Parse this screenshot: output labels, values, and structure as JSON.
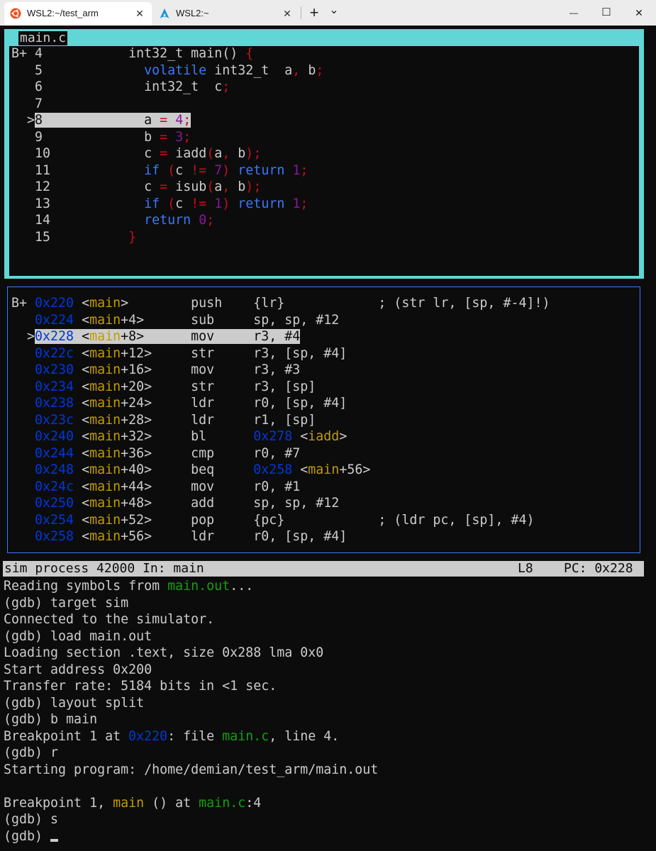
{
  "window": {
    "tabs": [
      {
        "title": "WSL2:~/test_arm",
        "icon": "ubuntu-icon",
        "active": true
      },
      {
        "title": "WSL2:~",
        "icon": "arch-icon",
        "active": false
      }
    ],
    "new_tab": "+",
    "dropdown": "⌄",
    "minimize": "—",
    "maximize": "☐",
    "close": "✕",
    "tab_close": "✕"
  },
  "source": {
    "filename": "main.c",
    "lines": [
      {
        "marker": "B+",
        "num": "4",
        "code": "int32_t main() {"
      },
      {
        "marker": "",
        "num": "5",
        "code": "volatile int32_t  a, b;"
      },
      {
        "marker": "",
        "num": "6",
        "code": "int32_t  c;"
      },
      {
        "marker": "",
        "num": "7",
        "code": ""
      },
      {
        "marker": ">",
        "num": "8",
        "code": "a = 4;",
        "current": true
      },
      {
        "marker": "",
        "num": "9",
        "code": "b = 3;"
      },
      {
        "marker": "",
        "num": "10",
        "code": "c = iadd(a, b);"
      },
      {
        "marker": "",
        "num": "11",
        "code": "if (c != 7) return 1;"
      },
      {
        "marker": "",
        "num": "12",
        "code": "c = isub(a, b);"
      },
      {
        "marker": "",
        "num": "13",
        "code": "if (c != 1) return 1;"
      },
      {
        "marker": "",
        "num": "14",
        "code": "return 0;"
      },
      {
        "marker": "",
        "num": "15",
        "code": "}"
      }
    ]
  },
  "asm": {
    "lines": [
      {
        "marker": "B+",
        "addr": "0x220",
        "sym": "main",
        "off": "",
        "op": "push",
        "args": "{lr}",
        "comment": "; (str lr, [sp, #-4]!)"
      },
      {
        "marker": "",
        "addr": "0x224",
        "sym": "main",
        "off": "+4",
        "op": "sub",
        "args": "sp, sp, #12",
        "comment": ""
      },
      {
        "marker": ">",
        "addr": "0x228",
        "sym": "main",
        "off": "+8",
        "op": "mov",
        "args": "r3, #4",
        "comment": "",
        "current": true
      },
      {
        "marker": "",
        "addr": "0x22c",
        "sym": "main",
        "off": "+12",
        "op": "str",
        "args": "r3, [sp, #4]",
        "comment": ""
      },
      {
        "marker": "",
        "addr": "0x230",
        "sym": "main",
        "off": "+16",
        "op": "mov",
        "args": "r3, #3",
        "comment": ""
      },
      {
        "marker": "",
        "addr": "0x234",
        "sym": "main",
        "off": "+20",
        "op": "str",
        "args": "r3, [sp]",
        "comment": ""
      },
      {
        "marker": "",
        "addr": "0x238",
        "sym": "main",
        "off": "+24",
        "op": "ldr",
        "args": "r0, [sp, #4]",
        "comment": ""
      },
      {
        "marker": "",
        "addr": "0x23c",
        "sym": "main",
        "off": "+28",
        "op": "ldr",
        "args": "r1, [sp]",
        "comment": ""
      },
      {
        "marker": "",
        "addr": "0x240",
        "sym": "main",
        "off": "+32",
        "op": "bl",
        "args": "",
        "target_addr": "0x278",
        "target_sym": "iadd",
        "target_off": "",
        "comment": ""
      },
      {
        "marker": "",
        "addr": "0x244",
        "sym": "main",
        "off": "+36",
        "op": "cmp",
        "args": "r0, #7",
        "comment": ""
      },
      {
        "marker": "",
        "addr": "0x248",
        "sym": "main",
        "off": "+40",
        "op": "beq",
        "args": "",
        "target_addr": "0x258",
        "target_sym": "main",
        "target_off": "+56",
        "comment": ""
      },
      {
        "marker": "",
        "addr": "0x24c",
        "sym": "main",
        "off": "+44",
        "op": "mov",
        "args": "r0, #1",
        "comment": ""
      },
      {
        "marker": "",
        "addr": "0x250",
        "sym": "main",
        "off": "+48",
        "op": "add",
        "args": "sp, sp, #12",
        "comment": ""
      },
      {
        "marker": "",
        "addr": "0x254",
        "sym": "main",
        "off": "+52",
        "op": "pop",
        "args": "{pc}",
        "comment": "; (ldr pc, [sp], #4)"
      },
      {
        "marker": "",
        "addr": "0x258",
        "sym": "main",
        "off": "+56",
        "op": "ldr",
        "args": "r0, [sp, #4]",
        "comment": ""
      }
    ]
  },
  "status": {
    "process": "sim process 42000 In: main",
    "line": "L8",
    "pc": "PC: 0x228"
  },
  "console": {
    "lines": [
      [
        {
          "t": "Reading symbols from "
        },
        {
          "t": "main.out",
          "c": "grn"
        },
        {
          "t": "..."
        }
      ],
      [
        {
          "t": "(gdb) target sim"
        }
      ],
      [
        {
          "t": "Connected to the simulator."
        }
      ],
      [
        {
          "t": "(gdb) load main.out"
        }
      ],
      [
        {
          "t": "Loading section .text, size 0x288 lma 0x0"
        }
      ],
      [
        {
          "t": "Start address 0x200"
        }
      ],
      [
        {
          "t": "Transfer rate: 5184 bits in <1 sec."
        }
      ],
      [
        {
          "t": "(gdb) layout split"
        }
      ],
      [
        {
          "t": "(gdb) b main"
        }
      ],
      [
        {
          "t": "Breakpoint 1 at "
        },
        {
          "t": "0x220",
          "c": "addr"
        },
        {
          "t": ": file "
        },
        {
          "t": "main.c",
          "c": "grn"
        },
        {
          "t": ", line 4."
        }
      ],
      [
        {
          "t": "(gdb) r"
        }
      ],
      [
        {
          "t": "Starting program: /home/demian/test_arm/main.out"
        }
      ],
      [
        {
          "t": ""
        }
      ],
      [
        {
          "t": "Breakpoint 1, "
        },
        {
          "t": "main",
          "c": "sym"
        },
        {
          "t": " () at "
        },
        {
          "t": "main.c",
          "c": "grn"
        },
        {
          "t": ":4"
        }
      ],
      [
        {
          "t": "(gdb) s"
        }
      ],
      [
        {
          "t": "(gdb) "
        }
      ]
    ]
  },
  "colors": {
    "background": "#0c0c0c",
    "foreground": "#cccccc",
    "frame_cyan": "#61d6d6",
    "address_blue": "#0037da",
    "keyword_blue": "#3b78ff",
    "symbol_yellow": "#c19c00",
    "green": "#13a10e",
    "number_magenta": "#881798",
    "punct_red": "#c50f1f"
  }
}
